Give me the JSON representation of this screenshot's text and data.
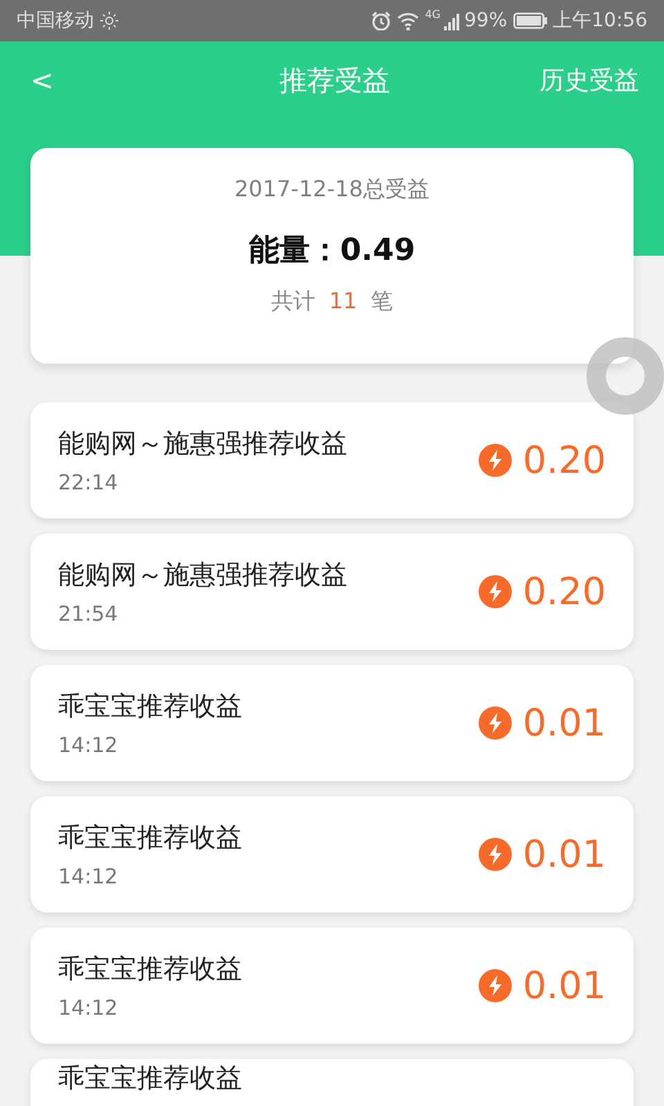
{
  "status_bar": {
    "carrier": "中国移动",
    "network": "4G",
    "battery": "99%",
    "time": "上午10:56"
  },
  "header": {
    "back": "<",
    "title": "推荐受益",
    "action": "历史受益"
  },
  "summary": {
    "date_label": "2017-12-18总受益",
    "total_label": "能量：",
    "total": "0.49",
    "count_prefix": "共计",
    "count": "11",
    "count_suffix": "笔"
  },
  "records": [
    {
      "title": "能购网～施惠强推荐收益",
      "time": "22:14",
      "amount": "0.20"
    },
    {
      "title": "能购网～施惠强推荐收益",
      "time": "21:54",
      "amount": "0.20"
    },
    {
      "title": "乖宝宝推荐收益",
      "time": "14:12",
      "amount": "0.01"
    },
    {
      "title": "乖宝宝推荐收益",
      "time": "14:12",
      "amount": "0.01"
    },
    {
      "title": "乖宝宝推荐收益",
      "time": "14:12",
      "amount": "0.01"
    },
    {
      "title": "乖宝宝推荐收益"
    }
  ]
}
